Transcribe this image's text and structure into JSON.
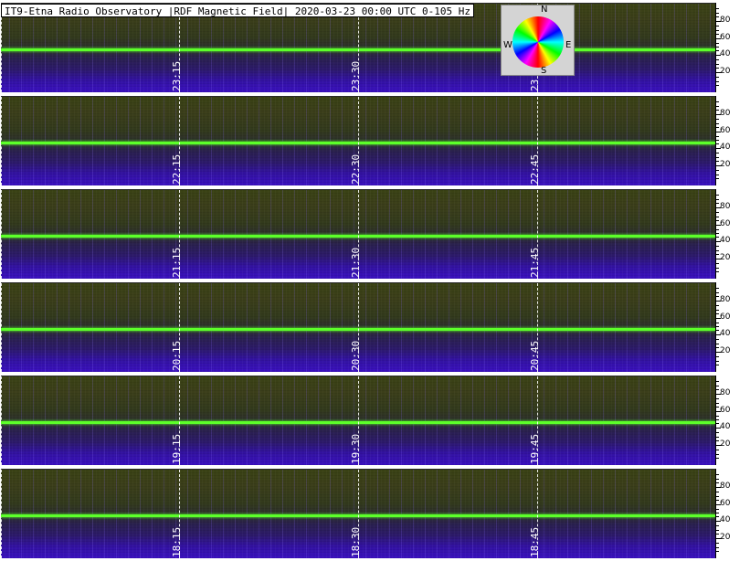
{
  "header": {
    "title": "IT9-Etna Radio Observatory |RDF Magnetic Field| 2020-03-23 00:00 UTC 0-105 Hz"
  },
  "compass": {
    "north": "N",
    "south": "S",
    "east": "E",
    "west": "W"
  },
  "colors": {
    "signal_line": "#5cff2a",
    "low_band": "#3a10c0",
    "high_band": "#3a4214"
  },
  "axis": {
    "tick_labels": [
      "80",
      "60",
      "40",
      "20"
    ]
  },
  "strips": [
    {
      "time_labels": [
        "23:15",
        "23:30",
        "23"
      ]
    },
    {
      "time_labels": [
        "22:15",
        "22:30",
        "22:45"
      ]
    },
    {
      "time_labels": [
        "21:15",
        "21:30",
        "21:45"
      ]
    },
    {
      "time_labels": [
        "20:15",
        "20:30",
        "20:45"
      ]
    },
    {
      "time_labels": [
        "19:15",
        "19:30",
        "19:45"
      ]
    },
    {
      "time_labels": [
        "18:15",
        "18:30",
        "18:45"
      ]
    }
  ]
}
